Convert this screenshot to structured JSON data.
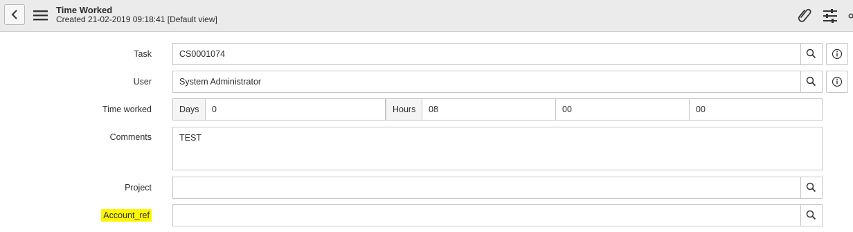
{
  "header": {
    "title": "Time Worked",
    "subtitle": "Created 21-02-2019 09:18:41 [Default view]"
  },
  "form": {
    "task": {
      "label": "Task",
      "value": "CS0001074"
    },
    "user": {
      "label": "User",
      "value": "System Administrator"
    },
    "time_worked": {
      "label": "Time worked",
      "days_label": "Days",
      "days_value": "0",
      "hours_label": "Hours",
      "hours_value": "08",
      "minutes_value": "00",
      "seconds_value": "00"
    },
    "comments": {
      "label": "Comments",
      "value": "TEST"
    },
    "project": {
      "label": "Project",
      "value": ""
    },
    "account_ref": {
      "label": "Account_ref",
      "value": "",
      "highlight_color": "#fff500"
    }
  },
  "icons": [
    "back-chevron",
    "hamburger-menu",
    "paperclip",
    "sliders",
    "magnifier",
    "info"
  ]
}
